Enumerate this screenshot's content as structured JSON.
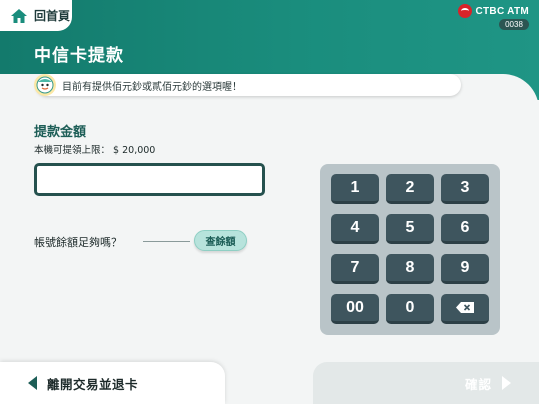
{
  "header": {
    "home_label": "回首頁",
    "home_icon": "home-icon",
    "brand_name": "CTBC ATM",
    "atm_id": "0038",
    "page_title": "中信卡提款"
  },
  "notice": {
    "text": "目前有提供佰元鈔或貳佰元鈔的選項喔！",
    "mascot_icon": "mascot-icon"
  },
  "withdraw": {
    "section_title": "提款金額",
    "limit_label": "本機可提領上限：",
    "limit_value": "$ 20,000",
    "amount_value": ""
  },
  "balance": {
    "question": "帳號餘額足夠嗎？",
    "button_label": "查餘額"
  },
  "keypad": {
    "keys": [
      "1",
      "2",
      "3",
      "4",
      "5",
      "6",
      "7",
      "8",
      "9",
      "00",
      "0"
    ],
    "backspace_icon": "backspace-icon"
  },
  "footer": {
    "exit_label": "離開交易並退卡",
    "confirm_label": "確認"
  },
  "colors": {
    "brand_teal": "#137a6c",
    "dark_teal": "#1d5e57",
    "key_fill": "#3e555e",
    "keypad_bg": "#b9c4c8",
    "logo_red": "#d8232a"
  }
}
